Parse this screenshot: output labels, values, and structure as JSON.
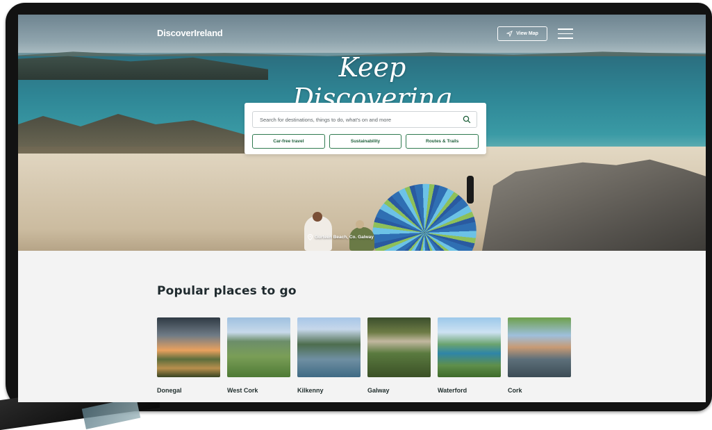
{
  "header": {
    "logo": "DiscoverIreland",
    "view_map_label": "View Map"
  },
  "hero": {
    "title": "Keep Discovering",
    "photo_credit": "Gurteen Beach, Co. Galway"
  },
  "search": {
    "placeholder": "Search for destinations, things to do, what's on and more",
    "chips": [
      "Car-free travel",
      "Sustainability",
      "Routes & Trails"
    ]
  },
  "popular": {
    "title": "Popular places to go",
    "places": [
      {
        "name": "Donegal"
      },
      {
        "name": "West Cork"
      },
      {
        "name": "Kilkenny"
      },
      {
        "name": "Galway"
      },
      {
        "name": "Waterford"
      },
      {
        "name": "Cork"
      }
    ]
  },
  "colors": {
    "brand_green": "#1b5e38",
    "chip_border": "#2f7a4f",
    "page_bg": "#f3f3f3"
  }
}
